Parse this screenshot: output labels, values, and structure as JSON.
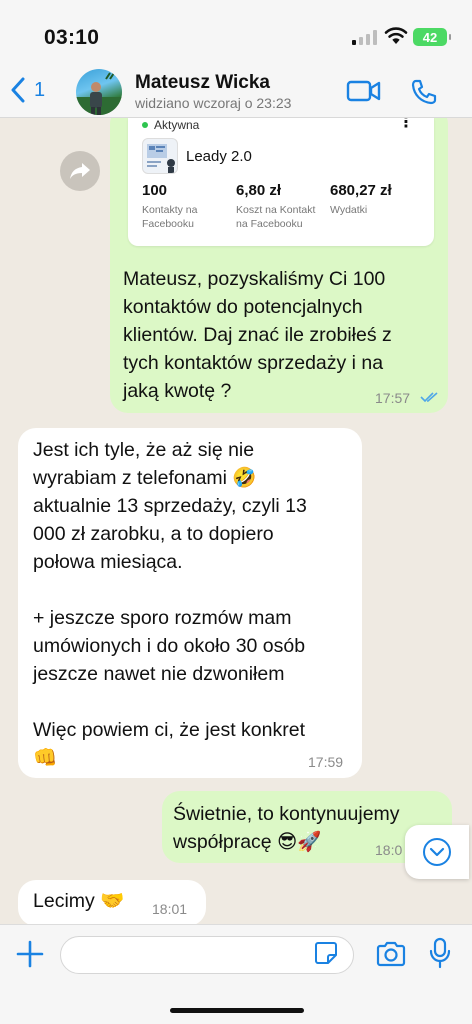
{
  "status_bar": {
    "time": "03:10",
    "battery": "42"
  },
  "header": {
    "back_count": "1",
    "contact_name": "Mateusz Wicka",
    "contact_status": "widziano wczoraj o 23:23"
  },
  "ad_card": {
    "status": "Aktywna",
    "title": "Leady 2.0",
    "stats": [
      {
        "value": "100",
        "label": "Kontakty na\nFacebooku"
      },
      {
        "value": "6,80 zł",
        "label": "Koszt na Kontakt\nna Facebooku"
      },
      {
        "value": "680,27 zł",
        "label": "Wydatki"
      }
    ]
  },
  "messages": [
    {
      "direction": "outgoing",
      "text": "Mateusz, pozyskaliśmy Ci 100\nkontaktów do potencjalnych\nklientów. Daj znać ile zrobiłeś z\ntych kontaktów sprzedaży i na\njaką kwotę ?",
      "time": "17:57"
    },
    {
      "direction": "incoming",
      "text": "Jest ich tyle, że aż się nie\nwyrabiam z telefonami 🤣\naktualnie 13 sprzedaży, czyli 13\n000 zł zarobku, a to dopiero\npołowa miesiąca.\n\n+ jeszcze sporo rozmów mam\numówionych i do około 30 osób\njeszcze nawet nie dzwoniłem\n\nWięc powiem ci, że jest konkret\n👊",
      "time": "17:59"
    },
    {
      "direction": "outgoing",
      "text": "Świetnie, to kontynuujemy\nwspółpracę 😎🚀",
      "time": "18:0"
    },
    {
      "direction": "incoming",
      "text": "Lecimy 🤝",
      "time": "18:01"
    }
  ],
  "colors": {
    "accent": "#1a82e2",
    "outgoing_bubble": "#dcf8c6",
    "incoming_bubble": "#ffffff",
    "chat_bg": "#efeae2",
    "read_ticks": "#4fa7e8"
  }
}
